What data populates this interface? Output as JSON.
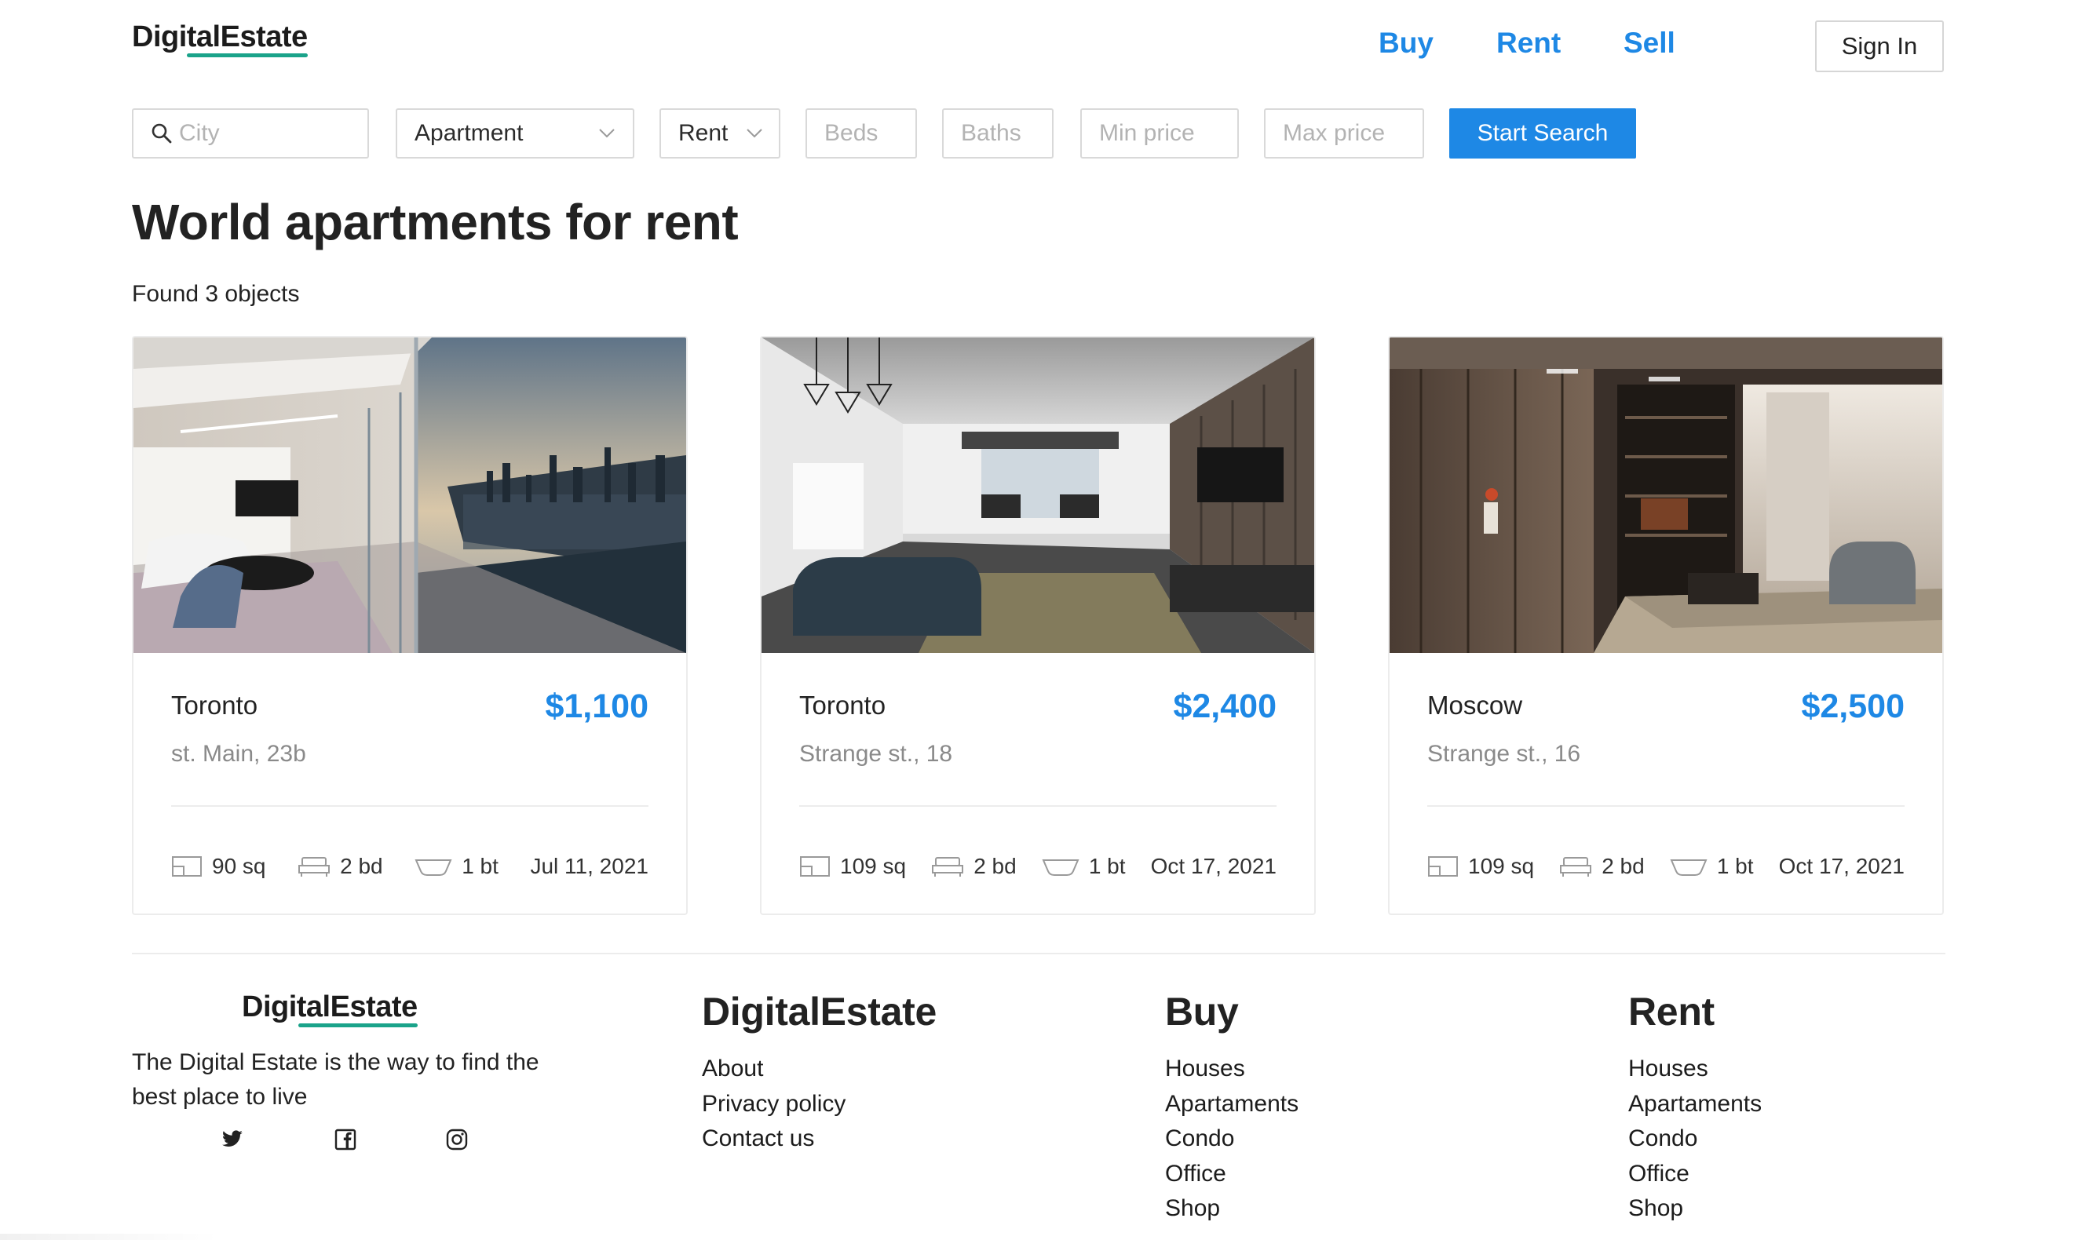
{
  "header": {
    "logo": "DigitalEstate",
    "nav": [
      {
        "label": "Buy"
      },
      {
        "label": "Rent"
      },
      {
        "label": "Sell"
      }
    ],
    "sign_in": "Sign In"
  },
  "search": {
    "city_placeholder": "City",
    "property_type": "Apartment",
    "mode": "Rent",
    "beds_placeholder": "Beds",
    "baths_placeholder": "Baths",
    "min_price_placeholder": "Min price",
    "max_price_placeholder": "Max price",
    "submit": "Start Search"
  },
  "main": {
    "title": "World apartments for rent",
    "found": "Found 3 objects",
    "listings": [
      {
        "city": "Toronto",
        "price": "$1,100",
        "address": "st. Main, 23b",
        "area": "90 sq",
        "beds": "2 bd",
        "baths": "1 bt",
        "date": "Jul 11, 2021"
      },
      {
        "city": "Toronto",
        "price": "$2,400",
        "address": "Strange st., 18",
        "area": "109 sq",
        "beds": "2 bd",
        "baths": "1 bt",
        "date": "Oct 17, 2021"
      },
      {
        "city": "Moscow",
        "price": "$2,500",
        "address": "Strange st., 16",
        "area": "109 sq",
        "beds": "2 bd",
        "baths": "1 bt",
        "date": "Oct 17, 2021"
      }
    ]
  },
  "footer": {
    "logo": "DigitalEstate",
    "tagline": "The Digital Estate is the way to find the best place to live",
    "social_icons": [
      "twitter-icon",
      "facebook-icon",
      "instagram-icon"
    ],
    "columns": [
      {
        "title": "DigitalEstate",
        "links": [
          "About",
          "Privacy policy",
          "Contact us"
        ]
      },
      {
        "title": "Buy",
        "links": [
          "Houses",
          "Apartaments",
          "Condo",
          "Office",
          "Shop"
        ]
      },
      {
        "title": "Rent",
        "links": [
          "Houses",
          "Apartaments",
          "Condo",
          "Office",
          "Shop"
        ]
      }
    ]
  },
  "colors": {
    "accent": "#1e88e5",
    "logo_underline": "#1aa38a",
    "text": "#222222",
    "muted": "#8a8a8a",
    "border": "#d9d9d9"
  }
}
